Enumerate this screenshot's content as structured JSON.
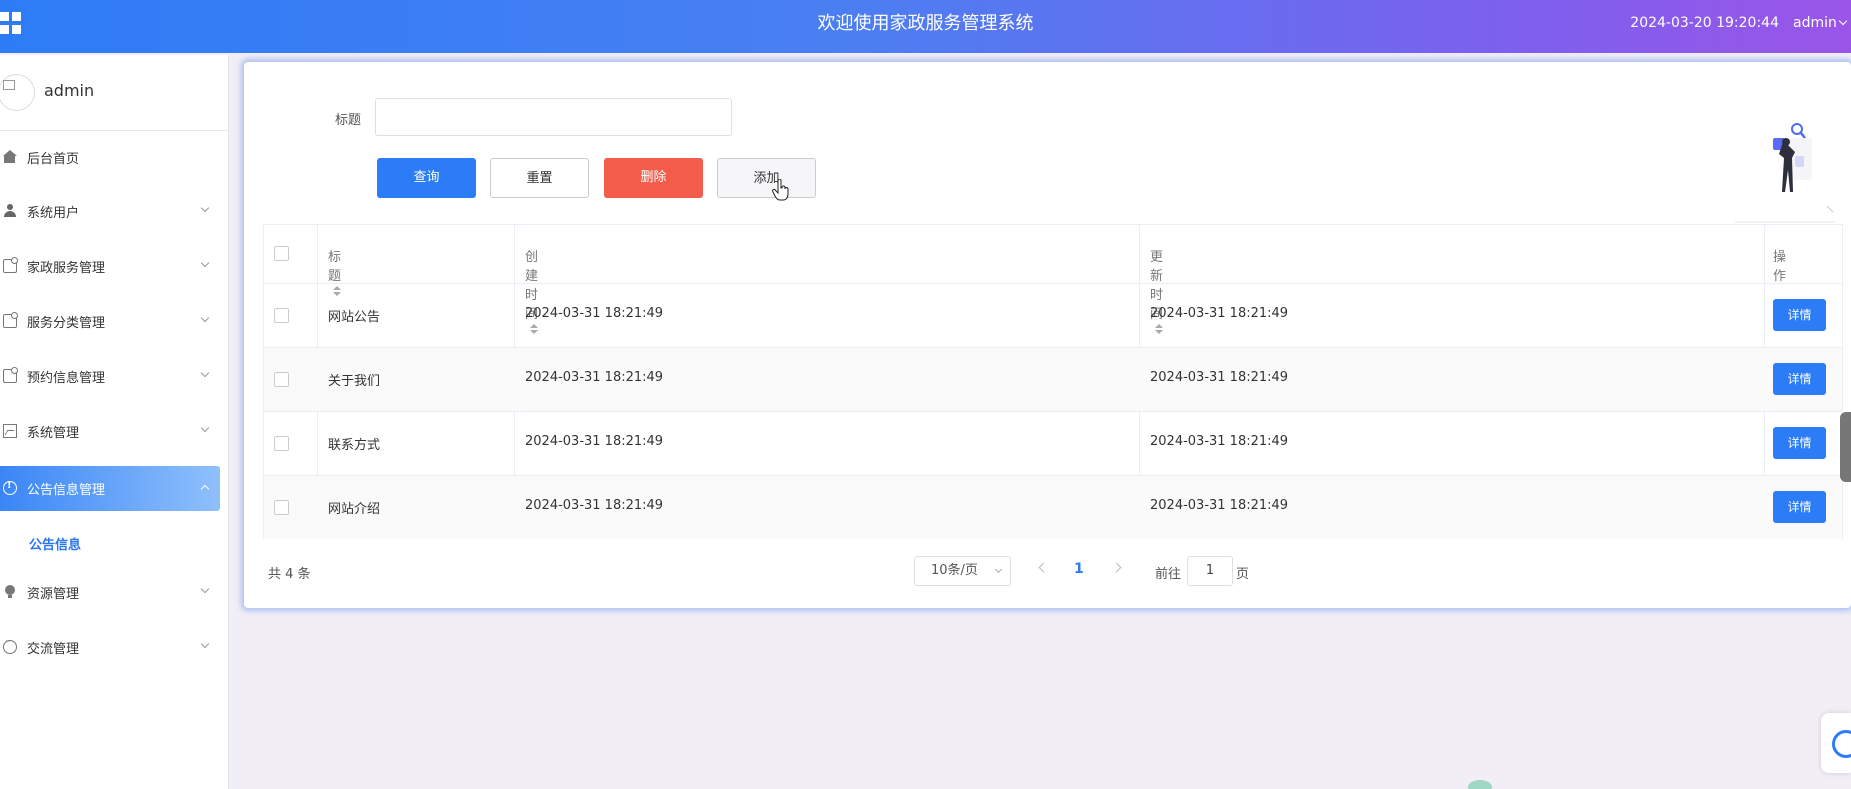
{
  "header": {
    "title": "欢迎使用家政服务管理系统",
    "datetime": "2024-03-20 19:20:44",
    "user": "admin"
  },
  "sidebar": {
    "profile_name": "admin",
    "items": [
      {
        "label": "后台首页",
        "icon": "home-icon"
      },
      {
        "label": "系统用户",
        "icon": "user-icon"
      },
      {
        "label": "家政服务管理",
        "icon": "document-icon"
      },
      {
        "label": "服务分类管理",
        "icon": "document-icon"
      },
      {
        "label": "预约信息管理",
        "icon": "document-icon"
      },
      {
        "label": "系统管理",
        "icon": "image-icon"
      },
      {
        "label": "公告信息管理",
        "icon": "info-icon"
      },
      {
        "label": "资源管理",
        "icon": "bulb-icon"
      },
      {
        "label": "交流管理",
        "icon": "chat-icon"
      }
    ],
    "active_sub": "公告信息"
  },
  "search": {
    "label": "标题",
    "value": "",
    "placeholder": ""
  },
  "toolbar": {
    "query": "查询",
    "reset": "重置",
    "delete": "删除",
    "add": "添加"
  },
  "table": {
    "columns": [
      "标题",
      "创建时间",
      "更新时间",
      "操作"
    ],
    "rows": [
      {
        "title": "网站公告",
        "created": "2024-03-31 18:21:49",
        "updated": "2024-03-31 18:21:49",
        "action": "详情"
      },
      {
        "title": "关于我们",
        "created": "2024-03-31 18:21:49",
        "updated": "2024-03-31 18:21:49",
        "action": "详情"
      },
      {
        "title": "联系方式",
        "created": "2024-03-31 18:21:49",
        "updated": "2024-03-31 18:21:49",
        "action": "详情"
      },
      {
        "title": "网站介绍",
        "created": "2024-03-31 18:21:49",
        "updated": "2024-03-31 18:21:49",
        "action": "详情"
      }
    ]
  },
  "pagination": {
    "total": "共 4 条",
    "page_size": "10条/页",
    "current": "1",
    "goto_label": "前往",
    "goto_value": "1",
    "goto_unit": "页"
  },
  "colors": {
    "primary": "#2b7cf6",
    "danger": "#f25d4c"
  }
}
